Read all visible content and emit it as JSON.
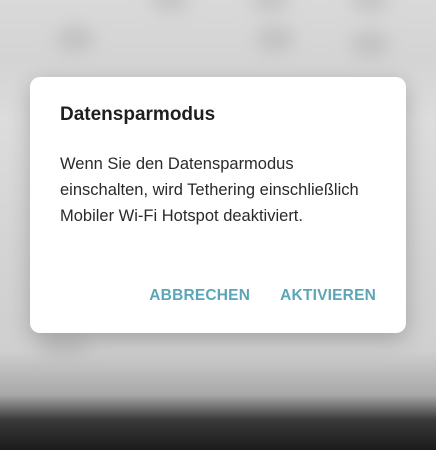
{
  "dialog": {
    "title": "Datensparmodus",
    "message": "Wenn Sie den Datensparmodus einschalten, wird Tethering einschließlich Mobiler Wi-Fi Hotspot deaktiviert.",
    "cancel_label": "ABBRECHEN",
    "confirm_label": "AKTIVIEREN"
  },
  "colors": {
    "accent": "#5aa6b7",
    "dialog_background": "#ffffff",
    "scrim": "#d6d6d6"
  }
}
